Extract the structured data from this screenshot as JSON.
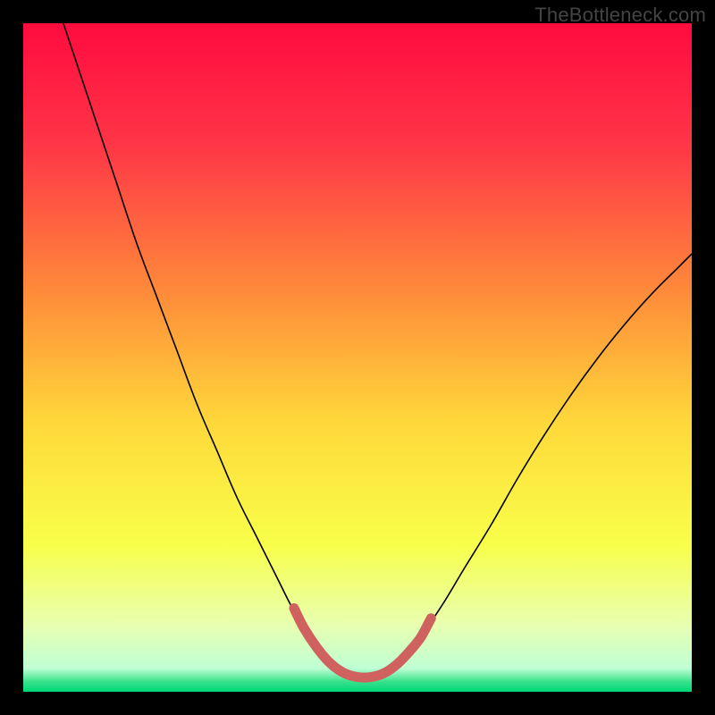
{
  "watermark": "TheBottleneck.com",
  "chart_data": {
    "type": "line",
    "title": "",
    "xlabel": "",
    "ylabel": "",
    "xlim": [
      0,
      100
    ],
    "ylim": [
      0,
      100
    ],
    "gradient_stops": [
      {
        "offset": 0,
        "color": "#ff0b3f"
      },
      {
        "offset": 0.18,
        "color": "#ff3547"
      },
      {
        "offset": 0.4,
        "color": "#ff8a3a"
      },
      {
        "offset": 0.6,
        "color": "#ffd93a"
      },
      {
        "offset": 0.78,
        "color": "#f8ff4a"
      },
      {
        "offset": 0.9,
        "color": "#e8ffb0"
      },
      {
        "offset": 0.965,
        "color": "#bfffd4"
      },
      {
        "offset": 0.985,
        "color": "#38e28b"
      },
      {
        "offset": 1,
        "color": "#00d67a"
      }
    ],
    "series": [
      {
        "name": "curve",
        "stroke": "#000000",
        "stroke_width": 1.6,
        "points": [
          [
            6,
            100
          ],
          [
            8,
            94
          ],
          [
            11,
            85
          ],
          [
            14,
            76
          ],
          [
            17,
            67
          ],
          [
            20,
            59
          ],
          [
            23,
            51
          ],
          [
            26,
            43
          ],
          [
            29,
            36
          ],
          [
            32,
            29
          ],
          [
            35,
            23
          ],
          [
            38,
            17
          ],
          [
            40,
            13
          ],
          [
            42,
            9.5
          ],
          [
            44,
            6.5
          ],
          [
            46,
            4.2
          ],
          [
            48,
            2.8
          ],
          [
            50,
            2.2
          ],
          [
            52,
            2.2
          ],
          [
            54,
            2.8
          ],
          [
            56,
            4.2
          ],
          [
            58,
            6.3
          ],
          [
            60,
            9.0
          ],
          [
            63,
            13.5
          ],
          [
            66,
            18.5
          ],
          [
            70,
            25
          ],
          [
            74,
            32
          ],
          [
            78,
            38.5
          ],
          [
            82,
            44.5
          ],
          [
            86,
            50
          ],
          [
            90,
            55
          ],
          [
            94,
            59.5
          ],
          [
            98,
            63.5
          ],
          [
            100,
            65.5
          ]
        ]
      },
      {
        "name": "bottom-highlight",
        "stroke": "#cf615f",
        "stroke_width": 11,
        "linecap": "round",
        "points": [
          [
            40.5,
            12.5
          ],
          [
            42,
            9.5
          ],
          [
            44,
            6.5
          ],
          [
            46,
            4.2
          ],
          [
            48,
            2.8
          ],
          [
            50,
            2.2
          ],
          [
            52,
            2.2
          ],
          [
            54,
            2.8
          ],
          [
            56,
            4.2
          ],
          [
            58,
            6.3
          ],
          [
            59.5,
            8.2
          ],
          [
            61,
            11
          ]
        ]
      }
    ]
  }
}
